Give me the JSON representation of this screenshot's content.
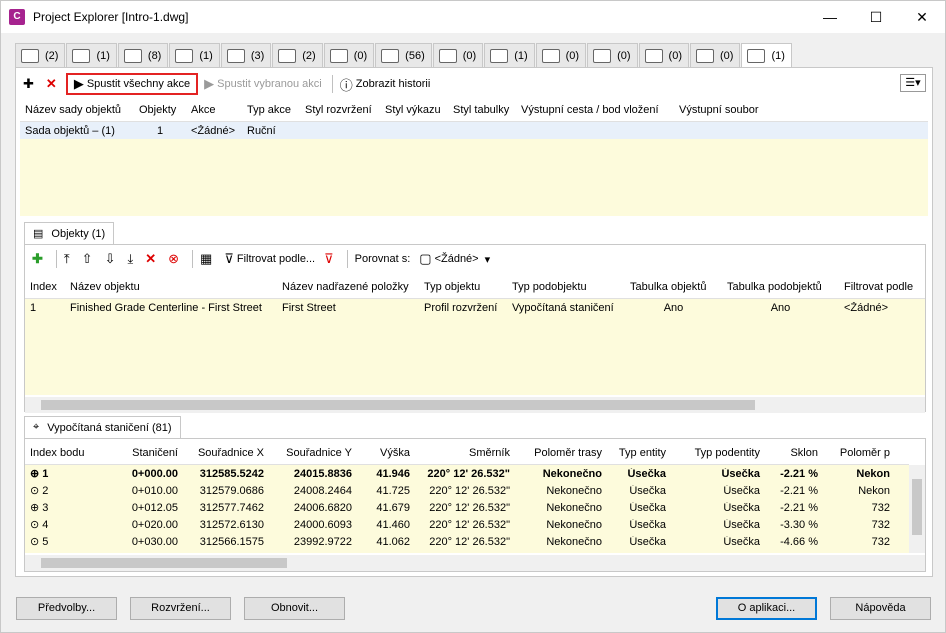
{
  "window": {
    "title": "Project Explorer [Intro-1.dwg]",
    "app_icon": "C",
    "minimize": "—",
    "maximize": "☐",
    "close": "✕"
  },
  "tabs": [
    {
      "count": "(2)",
      "icon": "alignment-icon"
    },
    {
      "count": "(1)",
      "icon": "surface-icon"
    },
    {
      "count": "(8)",
      "icon": "profile-icon"
    },
    {
      "count": "(1)",
      "icon": "profile-view-icon"
    },
    {
      "count": "(3)",
      "icon": "sample-line-icon"
    },
    {
      "count": "(2)",
      "icon": "assembly-icon"
    },
    {
      "count": "(0)",
      "icon": "feature-line-icon"
    },
    {
      "count": "(56)",
      "icon": "parcel-icon"
    },
    {
      "count": "(0)",
      "icon": "grading-icon"
    },
    {
      "count": "(1)",
      "icon": "corridor-icon"
    },
    {
      "count": "(0)",
      "icon": "pipe-icon"
    },
    {
      "count": "(0)",
      "icon": "pressure-icon"
    },
    {
      "count": "(0)",
      "icon": "intersection-icon"
    },
    {
      "count": "(0)",
      "icon": "table-icon"
    },
    {
      "count": "(1)",
      "icon": "object-set-icon"
    }
  ],
  "toolbar": {
    "run_all": "Spustit všechny akce",
    "run_selected": "Spustit vybranou akci",
    "history": "Zobrazit historii"
  },
  "sets_table": {
    "columns": [
      "Název sady objektů",
      "Objekty",
      "Akce",
      "Typ akce",
      "Styl rozvržení",
      "Styl výkazu",
      "Styl tabulky",
      "Výstupní cesta / bod vložení",
      "Výstupní soubor"
    ],
    "rows": [
      [
        "Sada objektů – (1)",
        "1",
        "<Žádné>",
        "Ruční",
        "",
        "",
        "",
        "",
        ""
      ]
    ]
  },
  "objects_tab": {
    "label": "Objekty (1)"
  },
  "objects_toolbar": {
    "filter": "Filtrovat podle...",
    "compare_label": "Porovnat s:",
    "compare_value": "<Žádné>"
  },
  "objects_table": {
    "columns": [
      "Index",
      "Název objektu",
      "Název nadřazené položky",
      "Typ objektu",
      "Typ podobjektu",
      "Tabulka objektů",
      "Tabulka podobjektů",
      "Filtrovat podle"
    ],
    "rows": [
      [
        "1",
        "Finished Grade Centerline - First Street",
        "First Street",
        "Profil rozvržení",
        "Vypočítaná staničení",
        "Ano",
        "Ano",
        "<Žádné>"
      ]
    ]
  },
  "stations_tab": {
    "label": "Vypočítaná staničení (81)"
  },
  "stations_table": {
    "columns": [
      "Index bodu",
      "Staničení",
      "Souřadnice X",
      "Souřadnice Y",
      "Výška",
      "Směrník",
      "Poloměr trasy",
      "Typ entity",
      "Typ podentity",
      "Sklon",
      "Poloměr p"
    ],
    "rows": [
      [
        "1",
        "0+000.00",
        "312585.5242",
        "24015.8836",
        "41.946",
        "220° 12' 26.532\"",
        "Nekonečno",
        "Úsečka",
        "Úsečka",
        "-2.21 %",
        "Nekon"
      ],
      [
        "2",
        "0+010.00",
        "312579.0686",
        "24008.2464",
        "41.725",
        "220° 12' 26.532\"",
        "Nekonečno",
        "Úsečka",
        "Úsečka",
        "-2.21 %",
        "Nekon"
      ],
      [
        "3",
        "0+012.05",
        "312577.7462",
        "24006.6820",
        "41.679",
        "220° 12' 26.532\"",
        "Nekonečno",
        "Úsečka",
        "Úsečka",
        "-2.21 %",
        "732"
      ],
      [
        "4",
        "0+020.00",
        "312572.6130",
        "24000.6093",
        "41.460",
        "220° 12' 26.532\"",
        "Nekonečno",
        "Úsečka",
        "Úsečka",
        "-3.30 %",
        "732"
      ],
      [
        "5",
        "0+030.00",
        "312566.1575",
        "23992.9722",
        "41.062",
        "220° 12' 26.532\"",
        "Nekonečno",
        "Úsečka",
        "Úsečka",
        "-4.66 %",
        "732"
      ]
    ]
  },
  "buttons": {
    "preferences": "Předvolby...",
    "layout": "Rozvržení...",
    "refresh": "Obnovit...",
    "about": "O aplikaci...",
    "help": "Nápověda"
  }
}
